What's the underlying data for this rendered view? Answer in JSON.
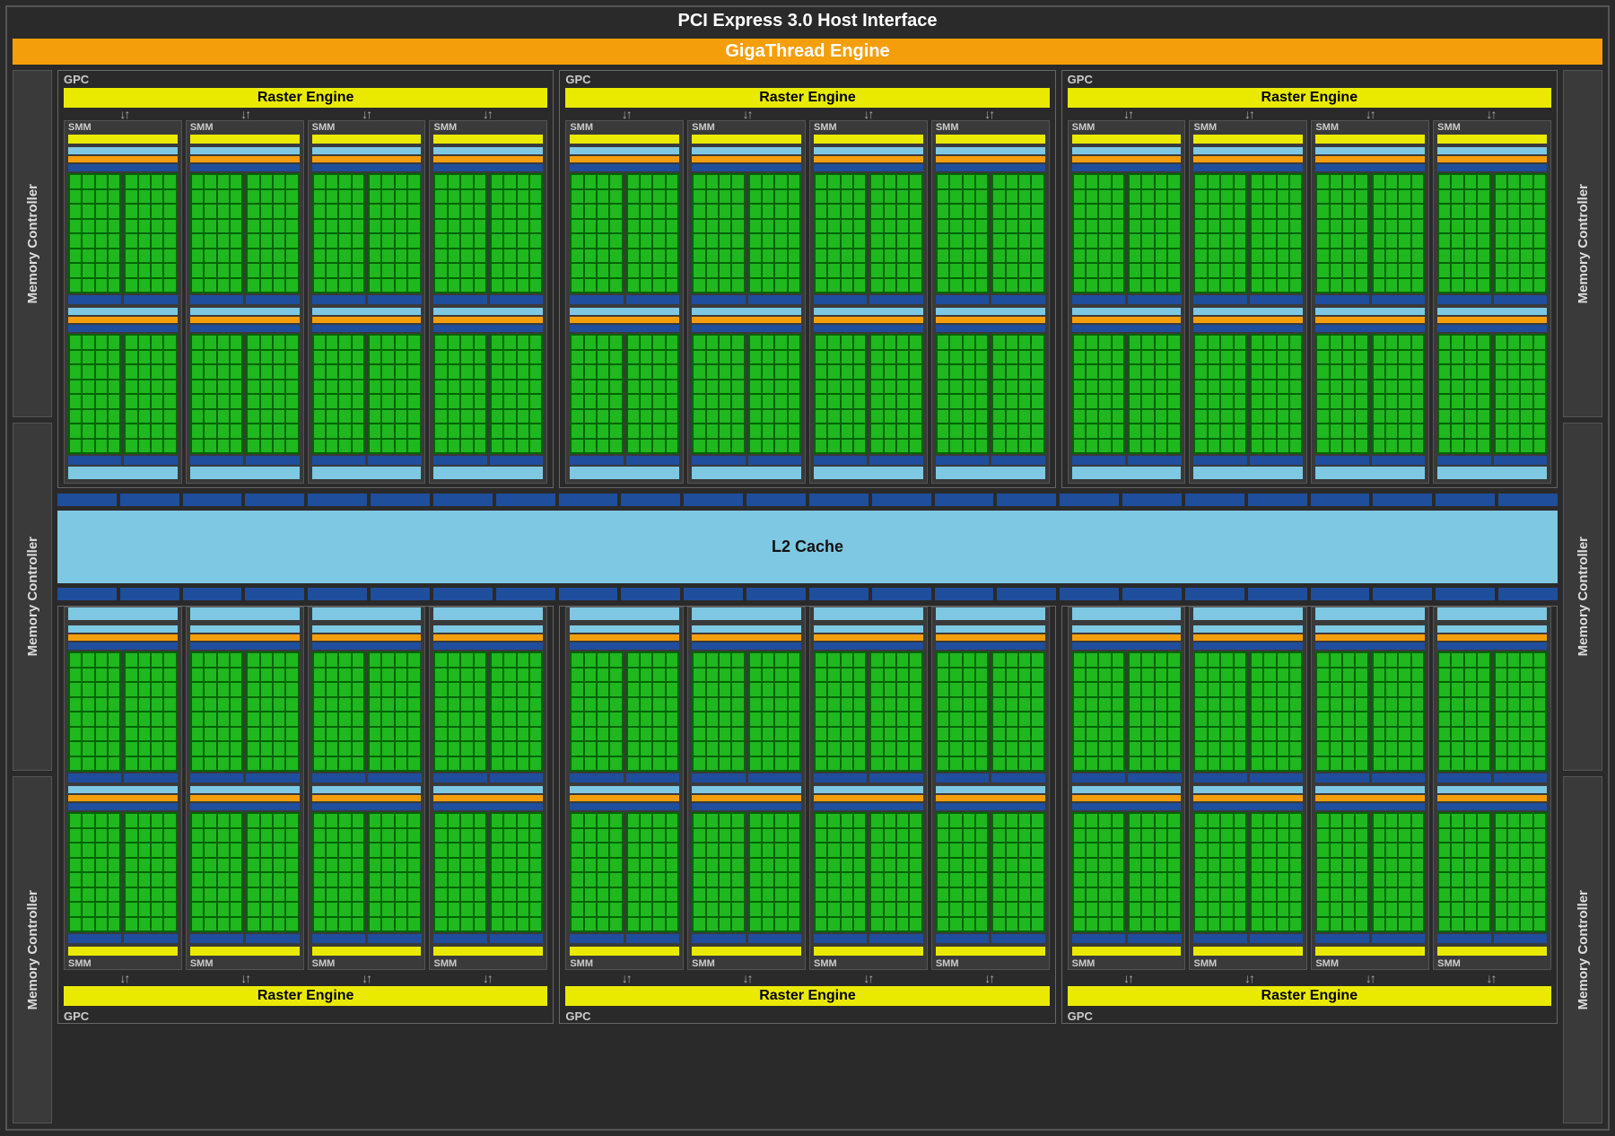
{
  "labels": {
    "pci": "PCI Express 3.0 Host Interface",
    "gigathread": "GigaThread Engine",
    "memory_controller": "Memory Controller",
    "gpc": "GPC",
    "raster": "Raster Engine",
    "smm": "SMM",
    "l2": "L2 Cache"
  },
  "architecture": {
    "gpc_count": 6,
    "smm_per_gpc": 4,
    "memory_controllers_per_side": 3,
    "processing_blocks_per_smm": 4,
    "cores_per_block_grid": "4x8",
    "l2_slices_per_row": 24,
    "gpc_rows": 2,
    "gpcs_per_row": 3
  },
  "colors": {
    "bg": "#2a2a2a",
    "engine": "#f59e0b",
    "raster": "#eaea00",
    "core_light": "#1fb81f",
    "core_dark": "#006400",
    "register": "#1f4e9c",
    "cache": "#7ec8e3",
    "dispatch": "#f59e0b"
  }
}
